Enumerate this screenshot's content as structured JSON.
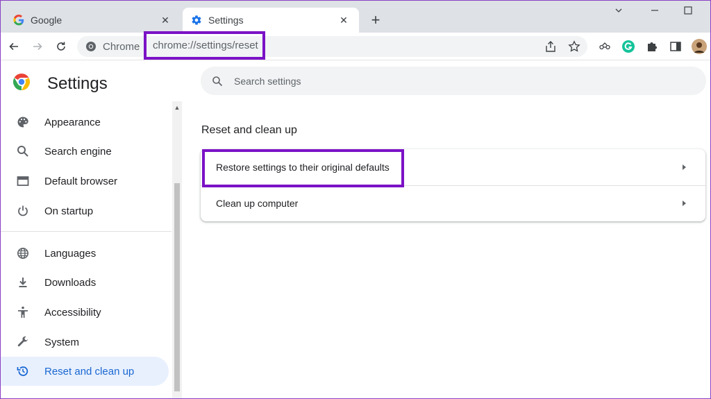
{
  "tabs": [
    {
      "title": "Google",
      "close": "✕"
    },
    {
      "title": "Settings",
      "close": "✕"
    }
  ],
  "new_tab": "+",
  "toolbar": {
    "chrome_label": "Chrome",
    "url": "chrome://settings/reset"
  },
  "sidebar": {
    "title": "Settings",
    "items": [
      {
        "label": "Appearance",
        "icon": "palette-icon"
      },
      {
        "label": "Search engine",
        "icon": "search-icon"
      },
      {
        "label": "Default browser",
        "icon": "browser-icon"
      },
      {
        "label": "On startup",
        "icon": "power-icon"
      },
      {
        "label": "Languages",
        "icon": "globe-icon"
      },
      {
        "label": "Downloads",
        "icon": "download-icon"
      },
      {
        "label": "Accessibility",
        "icon": "accessibility-icon"
      },
      {
        "label": "System",
        "icon": "wrench-icon"
      },
      {
        "label": "Reset and clean up",
        "icon": "history-reset-icon",
        "active": true
      }
    ]
  },
  "search": {
    "placeholder": "Search settings"
  },
  "main": {
    "section_title": "Reset and clean up",
    "rows": [
      {
        "label": "Restore settings to their original defaults"
      },
      {
        "label": "Clean up computer"
      }
    ]
  },
  "colors": {
    "highlight": "#7b12c6",
    "active_bg": "#e8f0fe",
    "active_text": "#1967d2",
    "grammarly": "#15c39a"
  }
}
